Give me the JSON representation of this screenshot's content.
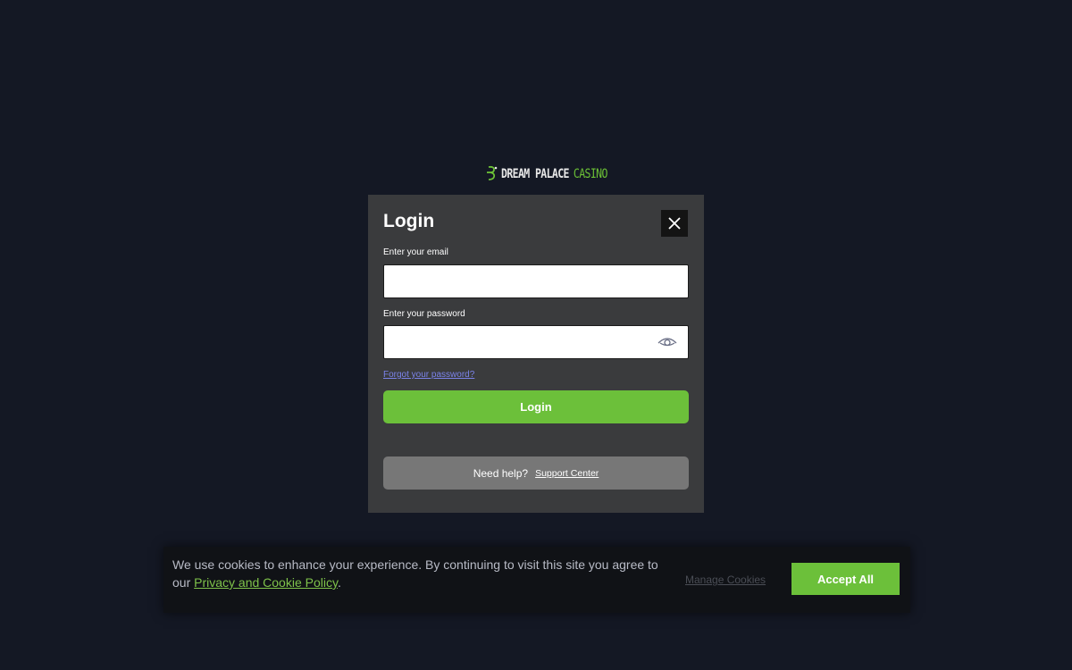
{
  "brand": {
    "logo_text_main": "DREAM PALACE",
    "logo_text_accent": "CASINO",
    "logo_icon": "dream-palace-logo-icon",
    "accent_color": "#6cc03a"
  },
  "login_modal": {
    "title": "Login",
    "close_icon": "close-icon",
    "email_label": "Enter your email",
    "email_value": "",
    "email_placeholder": "",
    "password_label": "Enter your password",
    "password_value": "",
    "password_placeholder": "",
    "show_password_icon": "eye-icon",
    "forgot_password_text": "Forgot your password?",
    "login_button_label": "Login",
    "help_text": "Need help?",
    "support_link_text": "Support Center"
  },
  "cookie_banner": {
    "message_prefix": "We use cookies to enhance your experience. By continuing to visit this site you agree to our",
    "policy_link_text": "Privacy and Cookie Policy",
    "message_suffix": ".",
    "manage_label": "Manage Cookies",
    "accept_label": "Accept All"
  }
}
